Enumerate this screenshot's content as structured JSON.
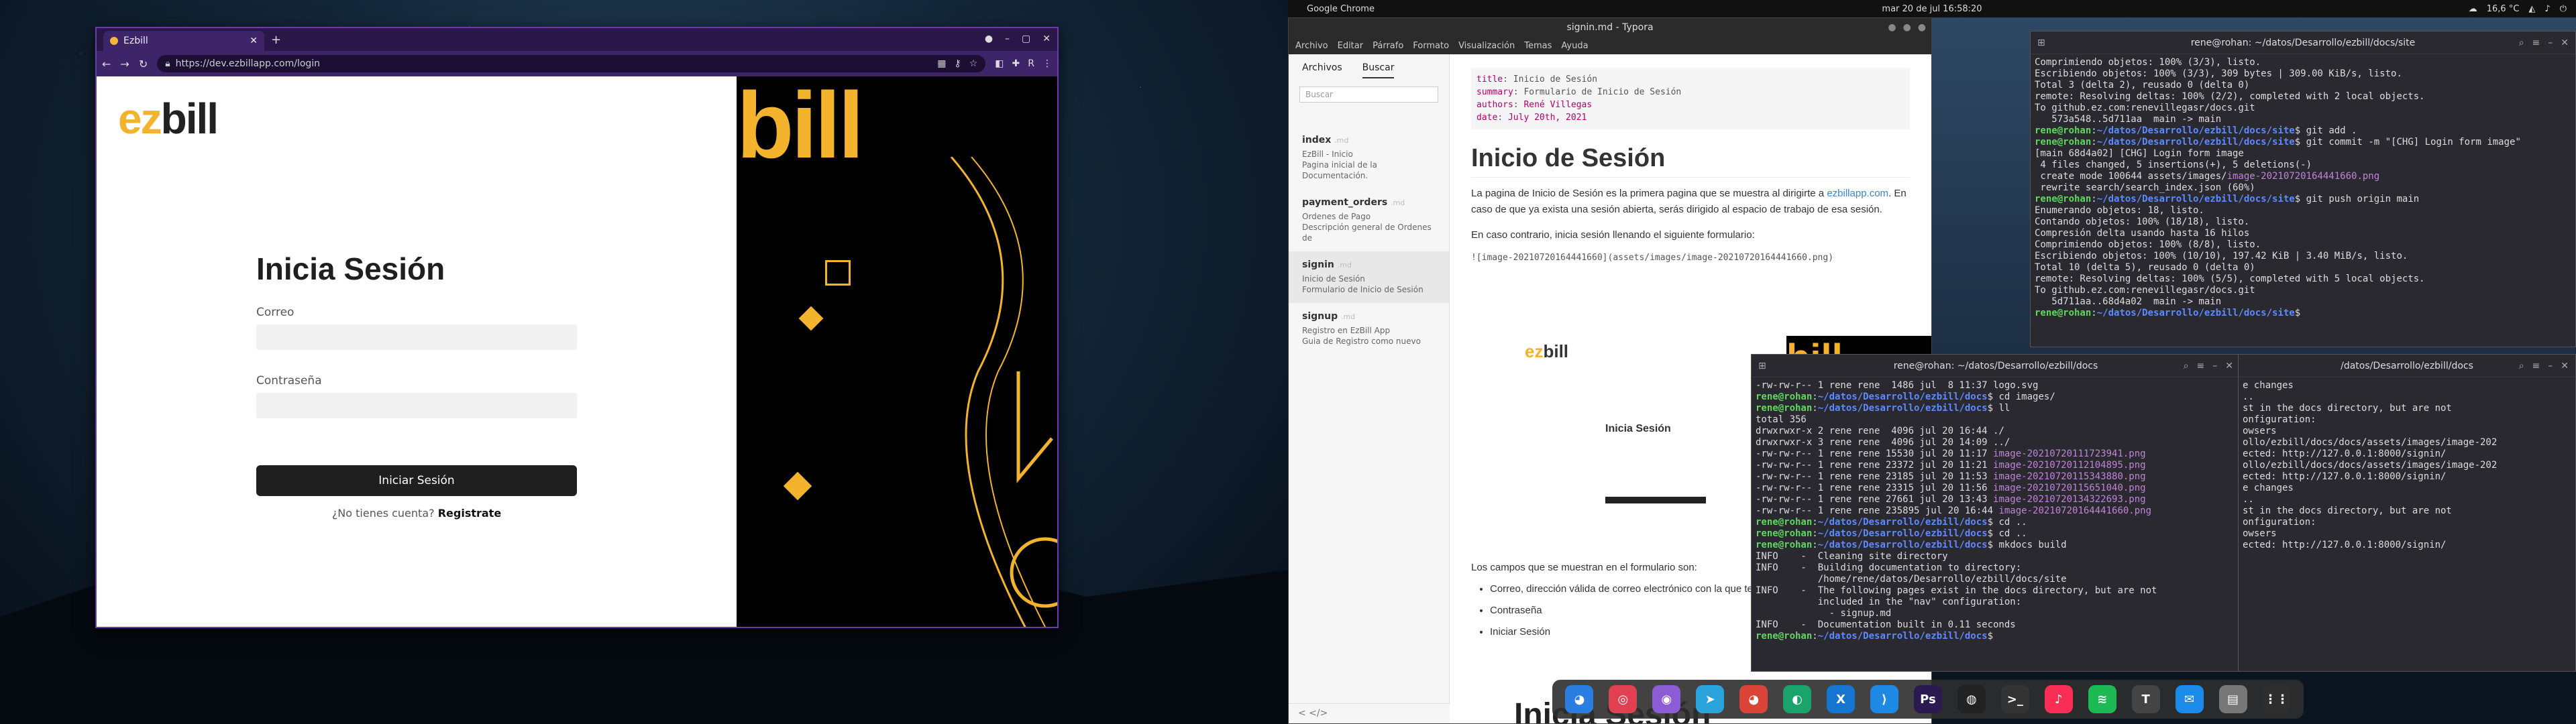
{
  "chrome": {
    "tab_title": "Ezbill",
    "url": "https://dev.ezbillapp.com/login",
    "win_controls": [
      "–",
      "▢",
      "✕"
    ]
  },
  "login": {
    "logo_a": "ez",
    "logo_b": "bill",
    "title": "Inicia Sesión",
    "email_label": "Correo",
    "password_label": "Contraseña",
    "submit_label": "Iniciar Sesión",
    "no_account": "¿No tienes cuenta?",
    "register": "Registrate"
  },
  "art": {
    "logo": "bill"
  },
  "topbar": {
    "app": "Google Chrome",
    "clock": "mar 20 de jul  16:58:20",
    "weather": "16,6 °C"
  },
  "typora": {
    "title": "signin.md - Typora",
    "menu": [
      "Archivo",
      "Editar",
      "Párrafo",
      "Formato",
      "Visualización",
      "Temas",
      "Ayuda"
    ],
    "tabs": [
      "Archivos",
      "Buscar"
    ],
    "search_placeholder": "Buscar",
    "files": [
      {
        "name": "index",
        "ext": ".md",
        "l1": "EzBill - Inicio",
        "l2": "Pagina inicial de la Documentación."
      },
      {
        "name": "payment_orders",
        "ext": ".md",
        "l1": "Ordenes de Pago",
        "l2": "Descripción general de Ordenes de"
      },
      {
        "name": "signin",
        "ext": ".md",
        "l1": "Inicio de Sesión",
        "l2": "Formulario de Inicio de Sesión"
      },
      {
        "name": "signup",
        "ext": ".md",
        "l1": "Registro en EzBill App",
        "l2": "Guia de Registro como nuevo"
      }
    ],
    "meta": [
      {
        "k": "title",
        "v": " Inicio de Sesión"
      },
      {
        "k": "summary",
        "v": " Formulario de Inicio de Sesión"
      },
      {
        "k": "authors",
        "v": " René Villegas"
      },
      {
        "k": "date",
        "v": " July 20th, 2021"
      }
    ],
    "h1": "Inicio de Sesión",
    "p1a": "La pagina de Inicio de Sesión es la primera pagina que se muestra al dirigirte a ",
    "p1link": "ezbillapp.com",
    "p1b": ". En caso de que ya exista una sesión abierta, serás dirigido al espacio de trabajo de esa sesión.",
    "p2": "En caso contrario, inicia sesión llenando el siguiente formulario:",
    "imgref": "![image-20210720164441660](assets/images/image-20210720164441660.png)",
    "p3": "Los campos que se muestran en el formulario son:",
    "li": [
      "Correo, dirección válida de correo electrónico con la que te registraste en EzBill",
      "Contraseña",
      "Iniciar Sesión"
    ],
    "bigh": "Inicia Sesión",
    "status": "<  </>"
  },
  "term1": {
    "title": "rene@rohan: ~/datos/Desarrollo/ezbill/docs/site",
    "lines": [
      "Comprimiendo objetos: 100% (3/3), listo.",
      "Escribiendo objetos: 100% (3/3), 309 bytes | 309.00 KiB/s, listo.",
      "Total 3 (delta 2), reusado 0 (delta 0)",
      "remote: Resolving deltas: 100% (2/2), completed with 2 local objects.",
      "To github.ez.com:renevillegasr/docs.git",
      "   573a548..5d711aa  main -> main",
      "$ git add .",
      "$ git commit -m \"[CHG] Login form image\"",
      "[main 68d4a02] [CHG] Login form image",
      " 4 files changed, 5 insertions(+), 5 deletions(-)",
      " create mode 100644 assets/images/image-20210720164441660.png",
      " rewrite search/search_index.json (60%)",
      "$ git push origin main",
      "Enumerando objetos: 18, listo.",
      "Contando objetos: 100% (18/18), listo.",
      "Compresión delta usando hasta 16 hilos",
      "Comprimiendo objetos: 100% (8/8), listo.",
      "Escribiendo objetos: 100% (10/10), 197.42 KiB | 3.40 MiB/s, listo.",
      "Total 10 (delta 5), reusado 0 (delta 0)",
      "remote: Resolving deltas: 100% (5/5), completed with 5 local objects.",
      "To github.ez.com:renevillegasr/docs.git",
      "   5d711aa..68d4a02  main -> main",
      "$ "
    ]
  },
  "term2": {
    "title": "rene@rohan: ~/datos/Desarrollo/ezbill/docs",
    "lines": [
      "-rw-rw-r-- 1 rene rene  1486 jul  8 11:37 logo.svg",
      "$ cd images/",
      "$ ll",
      "total 356",
      "drwxrwxr-x 2 rene rene  4096 jul 20 16:44 ./",
      "drwxrwxr-x 3 rene rene  4096 jul 20 14:09 ../",
      "-rw-rw-r-- 1 rene rene 15530 jul 20 11:17 image-20210720111723941.png",
      "-rw-rw-r-- 1 rene rene 23372 jul 20 11:21 image-20210720112104895.png",
      "-rw-rw-r-- 1 rene rene 23185 jul 20 11:53 image-20210720115343880.png",
      "-rw-rw-r-- 1 rene rene 23315 jul 20 11:56 image-20210720115651040.png",
      "-rw-rw-r-- 1 rene rene 27661 jul 20 13:43 image-20210720134322693.png",
      "-rw-rw-r-- 1 rene rene 235895 jul 20 16:44 image-20210720164441660.png",
      "$ cd ..",
      "$ cd ..",
      "$ mkdocs build",
      "INFO    -  Cleaning site directory",
      "INFO    -  Building documentation to directory:",
      "           /home/rene/datos/Desarrollo/ezbill/docs/site",
      "INFO    -  The following pages exist in the docs directory, but are not",
      "           included in the \"nav\" configuration:",
      "             - signup.md",
      "INFO    -  Documentation built in 0.11 seconds",
      "$ "
    ]
  },
  "term3": {
    "title": "/datos/Desarrollo/ezbill/docs",
    "lines": [
      "e changes",
      "..",
      "st in the docs directory, but are not",
      "onfiguration:",
      "",
      "owsers",
      "",
      "ollo/ezbill/docs/docs/assets/images/image-202",
      "",
      "",
      "ected: http://127.0.0.1:8000/signin/",
      "",
      "ollo/ezbill/docs/docs/assets/images/image-202",
      "",
      "ected: http://127.0.0.1:8000/signin/",
      "e changes",
      "..",
      "st in the docs directory, but are not",
      "onfiguration:",
      "",
      "owsers",
      "ected: http://127.0.0.1:8000/signin/"
    ]
  },
  "dock": [
    {
      "icon": "chrome-dock-icon",
      "c": "#2a7de1",
      "g": "◕"
    },
    {
      "icon": "target-dock-icon",
      "c": "#e04050",
      "g": "◎"
    },
    {
      "icon": "podcast-dock-icon",
      "c": "#8c5bd6",
      "g": "◉"
    },
    {
      "icon": "telegram-dock-icon",
      "c": "#2aa3dc",
      "g": "➤"
    },
    {
      "icon": "chrome-active-dock-icon",
      "c": "#db4437",
      "g": "◕"
    },
    {
      "icon": "edge-dock-icon",
      "c": "#1aa36a",
      "g": "◐"
    },
    {
      "icon": "xcode-dock-icon",
      "c": "#1576d2",
      "g": "X"
    },
    {
      "icon": "vscode-dock-icon",
      "c": "#1e88e5",
      "g": "⟩"
    },
    {
      "icon": "photoshop-dock-icon",
      "c": "#2b1a52",
      "g": "Ps"
    },
    {
      "icon": "github-dock-icon",
      "c": "#222",
      "g": "◍"
    },
    {
      "icon": "terminal-dock-icon",
      "c": "#333",
      "g": ">_"
    },
    {
      "icon": "music-dock-icon",
      "c": "#fa2d55",
      "g": "♪"
    },
    {
      "icon": "spotify-dock-icon",
      "c": "#1db954",
      "g": "≋"
    },
    {
      "icon": "typora-dock-icon",
      "c": "#444",
      "g": "T"
    },
    {
      "icon": "mail-dock-icon",
      "c": "#1b8ae8",
      "g": "✉"
    },
    {
      "icon": "files-dock-icon",
      "c": "#777",
      "g": "▤"
    },
    {
      "icon": "apps-grid-icon",
      "c": "#2e2e2e",
      "g": "⋮⋮"
    }
  ]
}
